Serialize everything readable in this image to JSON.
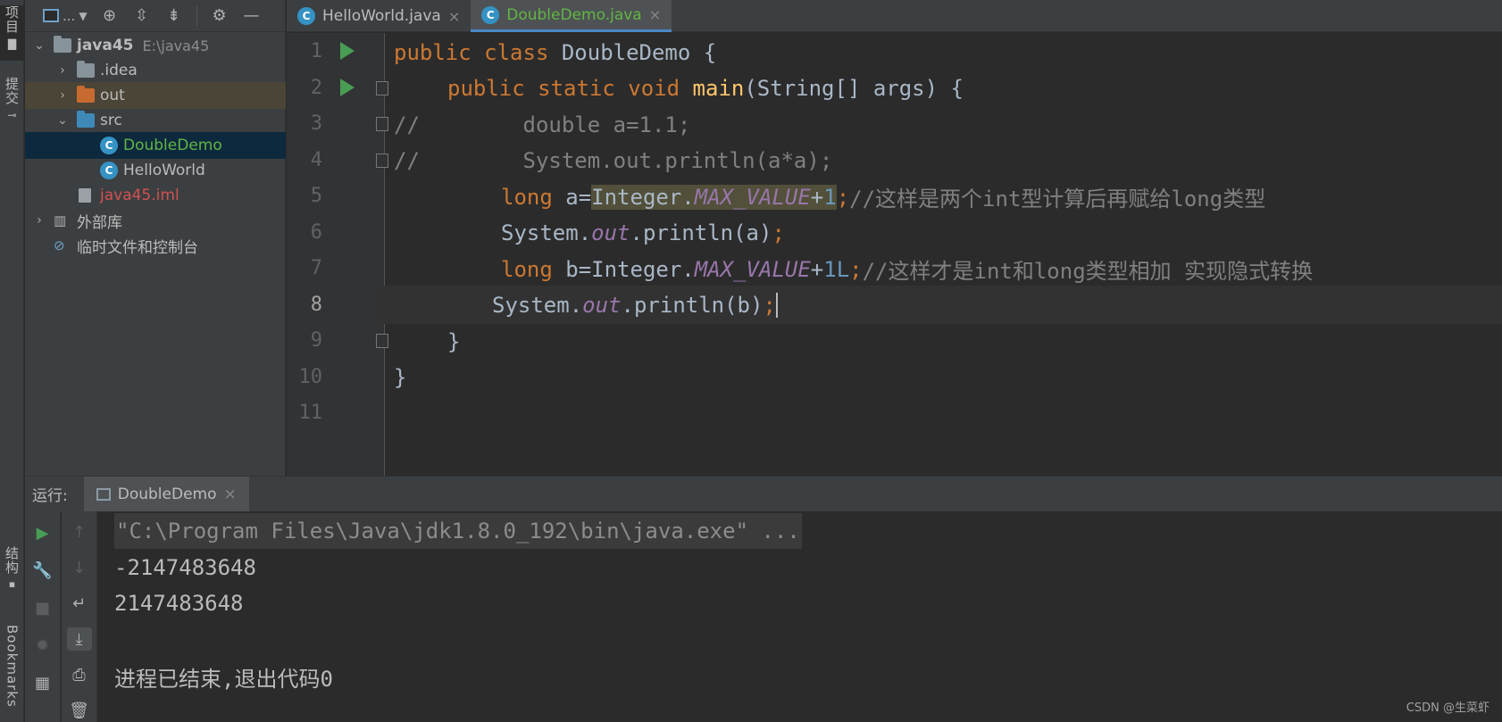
{
  "left_strip": {
    "project_tab": "项目",
    "commit_tab": "提交",
    "structure_tab": "结构",
    "bookmarks_tab": "Bookmarks"
  },
  "project_panel": {
    "toolbar_dropdown": "...",
    "tree": [
      {
        "label": "java45",
        "path": "E:\\java45"
      },
      {
        "label": ".idea"
      },
      {
        "label": "out"
      },
      {
        "label": "src"
      },
      {
        "label": "DoubleDemo"
      },
      {
        "label": "HelloWorld"
      },
      {
        "label": "java45.iml"
      },
      {
        "label": "外部库"
      },
      {
        "label": "临时文件和控制台"
      }
    ]
  },
  "tabs": [
    {
      "label": "HelloWorld.java"
    },
    {
      "label": "DoubleDemo.java"
    }
  ],
  "editor": {
    "line_numbers": [
      "1",
      "2",
      "3",
      "4",
      "5",
      "6",
      "7",
      "8",
      "9",
      "10",
      "11"
    ],
    "line1": {
      "kw": "public class",
      "rest": " DoubleDemo {"
    },
    "line2": {
      "kw": "public static void",
      "fn": "main",
      "rest": "(String[] args) {"
    },
    "line3": {
      "text": "//        double a=1.1;"
    },
    "line4": {
      "text": "//        System.out.println(a*a);"
    },
    "line5": {
      "kw": "long",
      "a": " a=",
      "cls": "Integer.",
      "fld": "MAX_VALUE",
      "plus": "+",
      "num": "1",
      "semi": ";",
      "comment": "//这样是两个int型计算后再赋给long类型"
    },
    "line6": {
      "a": "System.",
      "fld": "out",
      "b": ".println(a)",
      "semi": ";"
    },
    "line7": {
      "kw": "long",
      "a": " b=Integer.",
      "fld": "MAX_VALUE",
      "plus": "+",
      "num": "1L",
      "semi": ";",
      "comment": "//这样才是int和long类型相加 实现隐式转换"
    },
    "line8": {
      "a": "System.",
      "fld": "out",
      "b": ".println(b)",
      "semi": ";"
    },
    "line9": {
      "text": "}"
    },
    "line10": {
      "text": "}"
    }
  },
  "run": {
    "label": "运行:",
    "tab": "DoubleDemo",
    "console": [
      "\"C:\\Program Files\\Java\\jdk1.8.0_192\\bin\\java.exe\" ...",
      "-2147483648",
      "2147483648",
      "",
      "进程已结束,退出代码0"
    ]
  },
  "watermark": "CSDN @生菜虾"
}
